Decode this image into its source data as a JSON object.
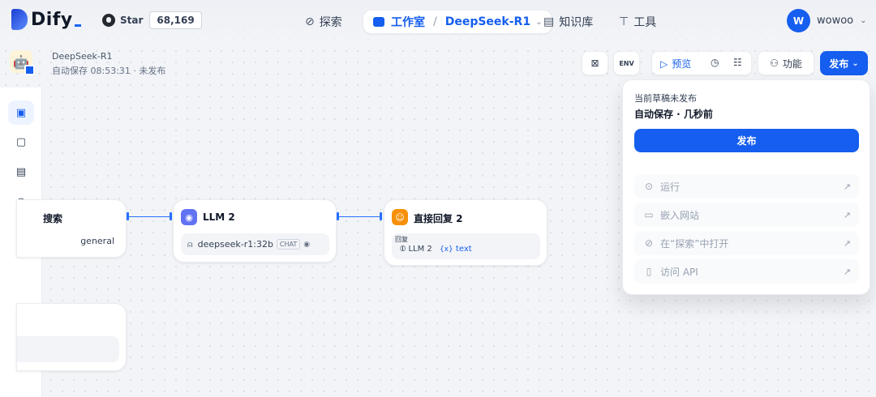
{
  "brand": {
    "name": "Dify",
    "github_label": "Star",
    "github_count": "68,169"
  },
  "nav": {
    "explore": "探索",
    "studio": "工作室",
    "current_app": "DeepSeek-R1",
    "knowledge": "知识库",
    "tools": "工具"
  },
  "user": {
    "initial": "W",
    "name": "wowoo"
  },
  "app": {
    "name": "DeepSeek-R1",
    "status": "自动保存 08:53:31 · 未发布"
  },
  "toolbar": {
    "env": "ENV",
    "preview": "预览",
    "features": "功能",
    "publish": "发布"
  },
  "nodes": {
    "partial_title": "搜索",
    "partial_value": "general",
    "llm": {
      "title": "LLM 2",
      "model": "deepseek-r1:32b",
      "mode": "CHAT"
    },
    "answer": {
      "title": "直接回复 2",
      "label": "回复",
      "source": "LLM 2",
      "var_symbol": "{x}",
      "var": "text"
    }
  },
  "publish_panel": {
    "title": "当前草稿未发布",
    "subtitle": "自动保存 · 几秒前",
    "publish_button": "发布",
    "items": [
      {
        "icon": "play-circle-icon",
        "label": "运行"
      },
      {
        "icon": "embed-icon",
        "label": "嵌入网站"
      },
      {
        "icon": "explore-icon",
        "label": "在“探索”中打开"
      },
      {
        "icon": "api-doc-icon",
        "label": "访问 API"
      }
    ]
  },
  "colors": {
    "primary": "#155eef",
    "edge": "#2970ff",
    "answer_icon": "#f79009",
    "llm_icon": "#6172f3"
  }
}
